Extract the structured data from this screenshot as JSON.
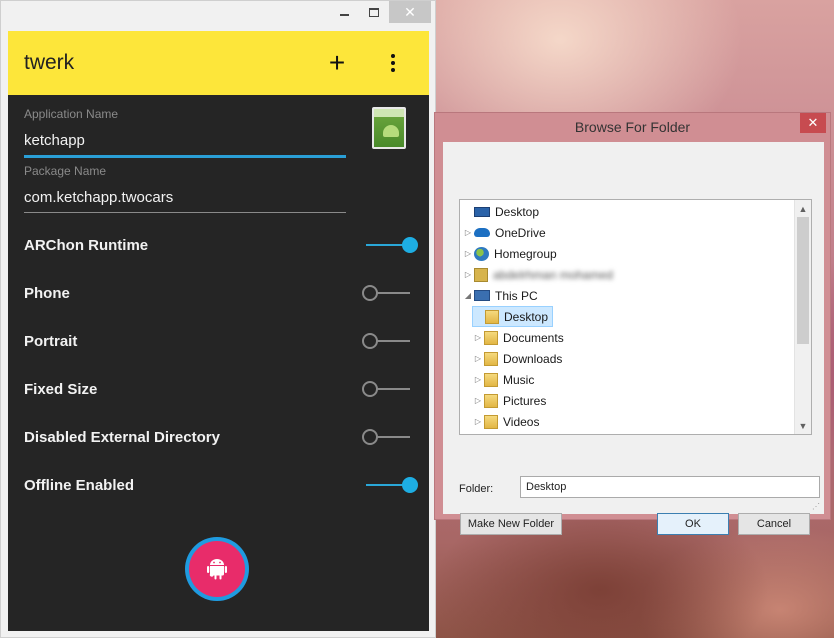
{
  "app": {
    "title": "twerk",
    "fields": {
      "application_name": {
        "label": "Application Name",
        "value": "ketchapp"
      },
      "package_name": {
        "label": "Package Name",
        "value": "com.ketchapp.twocars"
      }
    },
    "toggles": [
      {
        "label": "ARChon Runtime",
        "on": true
      },
      {
        "label": "Phone",
        "on": false
      },
      {
        "label": "Portrait",
        "on": false
      },
      {
        "label": "Fixed Size",
        "on": false
      },
      {
        "label": "Disabled External Directory",
        "on": false
      },
      {
        "label": "Offline Enabled",
        "on": true
      }
    ],
    "colors": {
      "app_bar": "#fde63a",
      "accent": "#1eaee3",
      "fab": "#e82c6a"
    }
  },
  "dialog": {
    "title": "Browse For Folder",
    "close_label": "✕",
    "tree": [
      {
        "label": "Desktop",
        "icon": "monitor-icon",
        "level": 0,
        "arrow": ""
      },
      {
        "label": "OneDrive",
        "icon": "cloud-icon",
        "level": 1,
        "arrow": "▷"
      },
      {
        "label": "Homegroup",
        "icon": "homegroup-icon",
        "level": 1,
        "arrow": "▷"
      },
      {
        "label": "abdelrhman mohamed",
        "icon": "user-icon",
        "level": 1,
        "arrow": "▷",
        "blurred": true
      },
      {
        "label": "This PC",
        "icon": "pc-icon",
        "level": 1,
        "arrow": "◢"
      },
      {
        "label": "Desktop",
        "icon": "folder-icon",
        "level": 2,
        "arrow": "",
        "selected": true
      },
      {
        "label": "Documents",
        "icon": "folder-icon",
        "level": 2,
        "arrow": "▷"
      },
      {
        "label": "Downloads",
        "icon": "folder-icon",
        "level": 2,
        "arrow": "▷"
      },
      {
        "label": "Music",
        "icon": "folder-icon",
        "level": 2,
        "arrow": "▷"
      },
      {
        "label": "Pictures",
        "icon": "folder-icon",
        "level": 2,
        "arrow": "▷"
      },
      {
        "label": "Videos",
        "icon": "folder-icon",
        "level": 2,
        "arrow": "▷"
      }
    ],
    "folder_label": "Folder:",
    "folder_value": "Desktop",
    "buttons": {
      "make_new_folder": "Make New Folder",
      "ok": "OK",
      "cancel": "Cancel"
    }
  }
}
